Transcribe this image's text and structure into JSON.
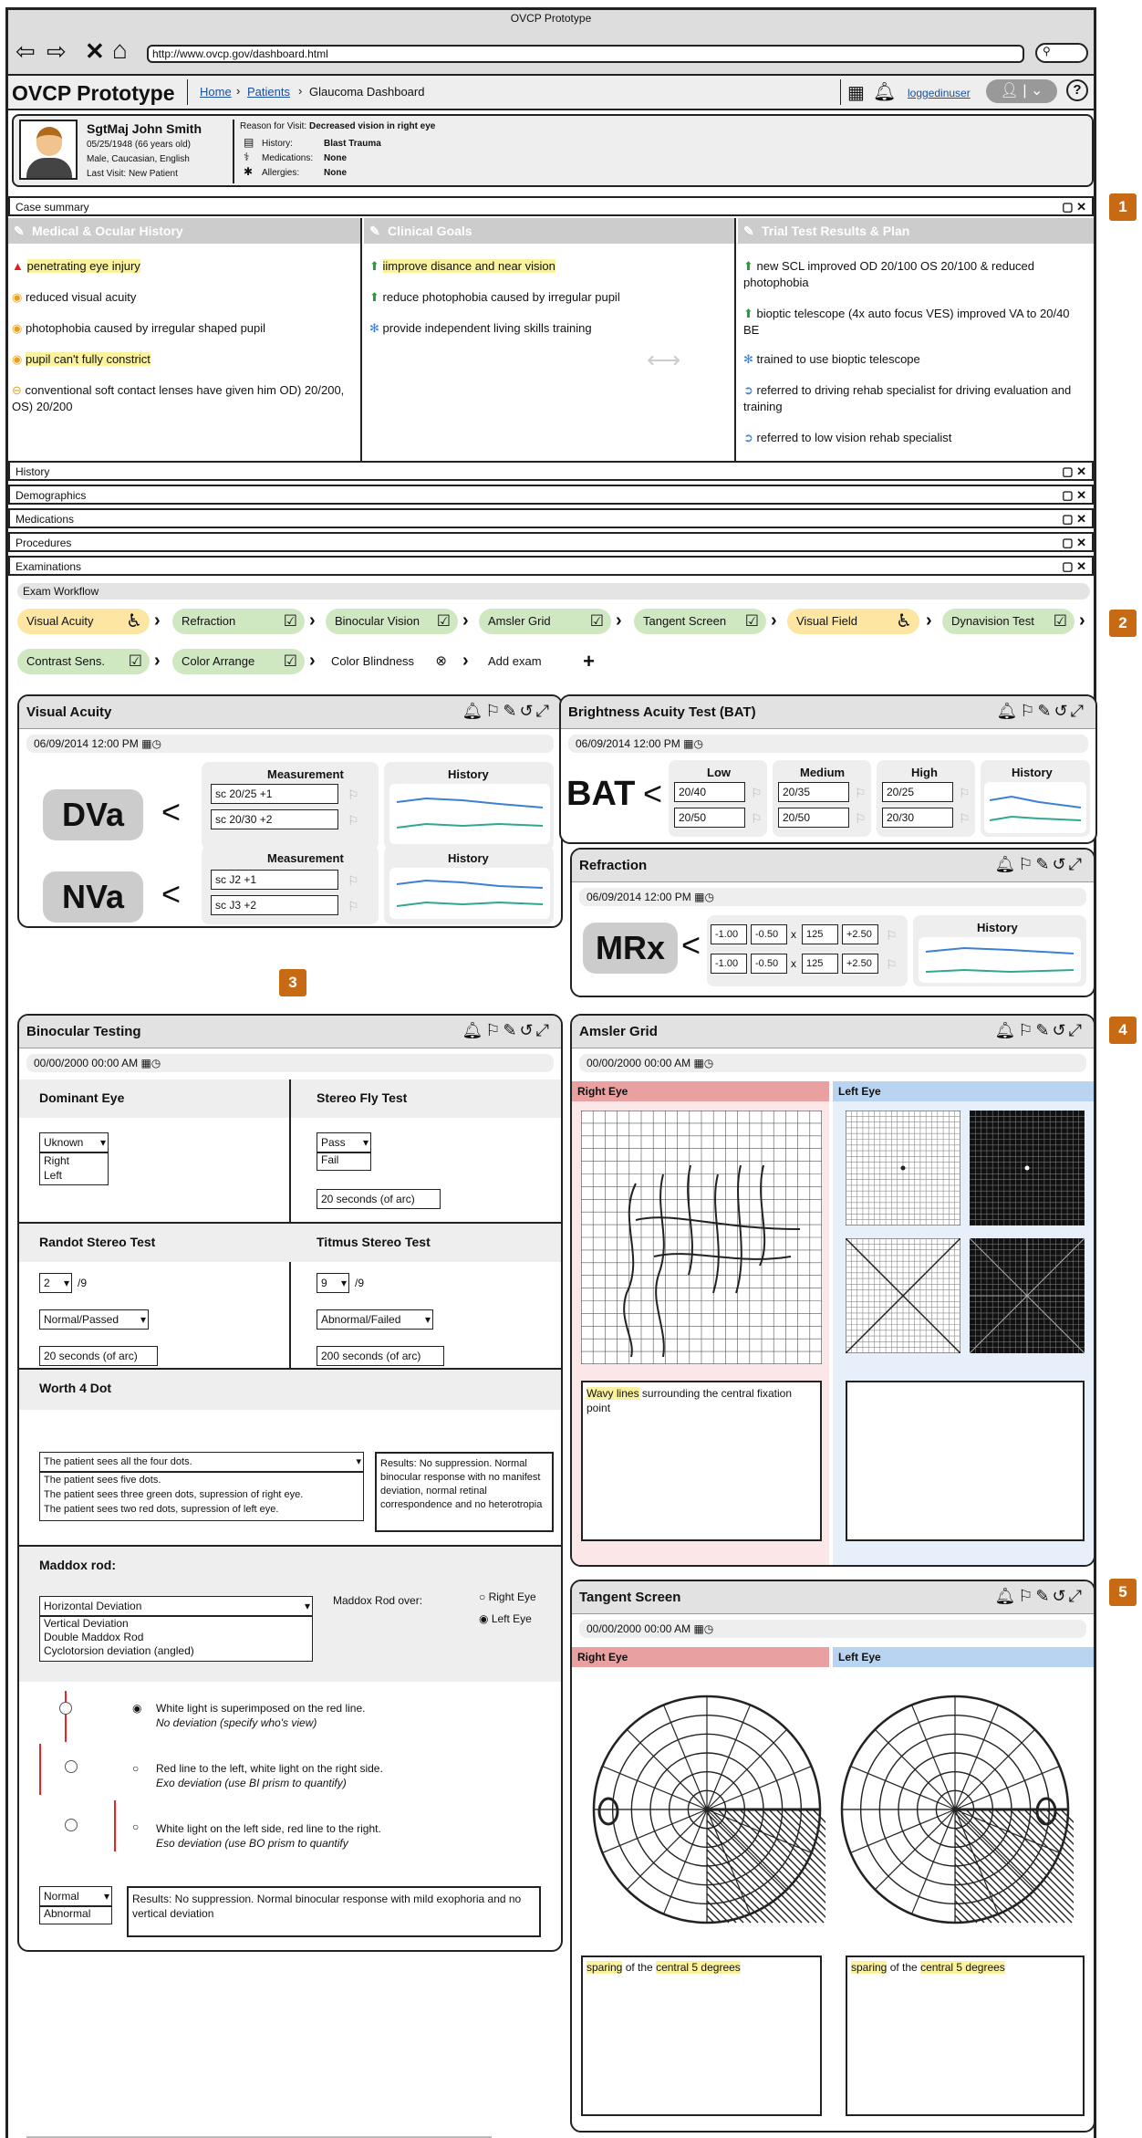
{
  "browser": {
    "title": "OVCP Prototype",
    "url": "http://www.ovcp.gov/dashboard.html"
  },
  "app": {
    "name": "OVCP Prototype",
    "crumbs": [
      "Home",
      "Patients",
      "Glaucoma Dashboard"
    ],
    "user": "loggedinuser"
  },
  "patient": {
    "name": "SgtMaj John Smith",
    "dob": "05/25/1948 (66 years old)",
    "demo": "Male, Caucasian, English",
    "last": "Last Visit: New Patient",
    "reason_label": "Reason for Visit:",
    "reason": "Decreased vision in right eye",
    "history_label": "History:",
    "history": "Blast Trauma",
    "meds_label": "Medications:",
    "meds": "None",
    "allergies_label": "Allergies:",
    "allergies": "None"
  },
  "bars": {
    "case": "Case summary",
    "history": "History",
    "demographics": "Demographics",
    "medications": "Medications",
    "procedures": "Procedures",
    "examinations": "Examinations"
  },
  "badges": [
    "1",
    "2",
    "3",
    "4",
    "5"
  ],
  "summary": {
    "col1": {
      "title": "Medical & Ocular History",
      "items": [
        "penetrating eye injury",
        "reduced visual acuity",
        "photophobia caused by irregular shaped pupil",
        "pupil can't fully constrict",
        "conventional soft contact lenses have given him OD) 20/200, OS) 20/200"
      ]
    },
    "col2": {
      "title": "Clinical Goals",
      "items": [
        "iimprove disance and near vision",
        "reduce photophobia caused by irregular pupil",
        "provide independent living skills training"
      ]
    },
    "col3": {
      "title": "Trial Test Results & Plan",
      "items": [
        "new SCL improved OD 20/100 OS 20/100 & reduced photophobia",
        "bioptic telescope (4x auto focus VES) improved VA to 20/40 BE",
        "trained to use bioptic telescope",
        "referred to driving rehab specialist for driving evaluation and training",
        "referred to low vision rehab specialist"
      ]
    }
  },
  "workflow": {
    "title": "Exam Workflow",
    "row1": [
      "Visual Acuity",
      "Refraction",
      "Binocular Vision",
      "Amsler Grid",
      "Tangent Screen",
      "Visual Field",
      "Dynavision Test"
    ],
    "row2": [
      "Contrast Sens.",
      "Color Arrange",
      "Color Blindness",
      "Add exam"
    ]
  },
  "va": {
    "title": "Visual Acuity",
    "date": "06/09/2014 12:00 PM",
    "measurement": "Measurement",
    "history": "History",
    "dva": "DVa",
    "nva": "NVa",
    "dva_vals": [
      "sc 20/25 +1",
      "sc 20/30 +2"
    ],
    "nva_vals": [
      "sc J2 +1",
      "sc J3 +2"
    ]
  },
  "bat": {
    "title": "Brightness Acuity Test (BAT)",
    "date": "06/09/2014 12:00 PM",
    "big": "BAT",
    "low": "Low",
    "medium": "Medium",
    "high": "High",
    "history": "History",
    "low_vals": [
      "20/40",
      "20/50"
    ],
    "med_vals": [
      "20/35",
      "20/50"
    ],
    "high_vals": [
      "20/25",
      "20/30"
    ]
  },
  "refraction": {
    "title": "Refraction",
    "date": "06/09/2014 12:00 PM",
    "big": "MRx",
    "history": "History",
    "row1": [
      "-1.00",
      "-0.50",
      "125",
      "+2.50"
    ],
    "row2": [
      "-1.00",
      "-0.50",
      "125",
      "+2.50"
    ]
  },
  "binocular": {
    "title": "Binocular Testing",
    "date": "00/00/2000 00:00 AM",
    "dominant": {
      "title": "Dominant Eye",
      "sel": "Uknown",
      "opts": [
        "Right",
        "Left"
      ]
    },
    "stereofly": {
      "title": "Stereo Fly Test",
      "sel": "Pass",
      "opts": [
        "Fail"
      ],
      "secs": "20 seconds (of arc)"
    },
    "randot": {
      "title": "Randot Stereo Test",
      "num": "2",
      "of": "/9",
      "result": "Normal/Passed",
      "secs": "20 seconds (of arc)"
    },
    "titmus": {
      "title": "Titmus Stereo Test",
      "num": "9",
      "of": "/9",
      "result": "Abnormal/Failed",
      "secs": "200 seconds (of arc)"
    },
    "worth": {
      "title": "Worth 4 Dot",
      "sel": "The patient sees all the four dots.",
      "opts": [
        "The patient sees five dots.",
        "The patient sees three green dots, supression of right eye.",
        "The patient sees two red dots, supression of left eye."
      ],
      "result": "Results: No suppression. Normal binocular response with no manifest deviation, normal retinal correspondence and no heterotropia"
    },
    "maddox": {
      "title": "Maddox rod:",
      "sel": "Horizontal Deviation",
      "opts": [
        "Vertical Deviation",
        "Double Maddox Rod",
        "Cyclotorsion deviation (angled)"
      ],
      "over": "Maddox Rod over:",
      "right": "Right Eye",
      "left": "Left Eye",
      "opt1a": "White light is superimposed on the red line.",
      "opt1b": "No deviation (specify who's view)",
      "opt2a": "Red line to the left, white light on the right side.",
      "opt2b": "Exo deviation (use BI prism to quantify)",
      "opt3a": "White light on the left side, red line to the right.",
      "opt3b": "Eso deviation (use BO prism to quantify",
      "normal": "Normal",
      "abnormal": "Abnormal",
      "result": "Results: No suppression. Normal binocular response with mild exophoria and no vertical deviation"
    }
  },
  "amsler": {
    "title": "Amsler Grid",
    "date": "00/00/2000 00:00 AM",
    "right": "Right Eye",
    "left": "Left Eye",
    "note_hl": "Wavy lines",
    "note": " surrounding the central fixation point"
  },
  "tangent": {
    "title": "Tangent Screen",
    "date": "00/00/2000 00:00 AM",
    "right": "Right Eye",
    "left": "Left Eye",
    "note_a": "sparing",
    "note_b": " of the ",
    "note_c": "central 5 degrees"
  },
  "colors": {
    "red": "#e8a0a0",
    "blue": "#b9d4f1",
    "yellow": "#fbf2a0",
    "green": "#cfe8c2",
    "orange": "#c86a14",
    "line_blue": "#3c7fd6",
    "line_teal": "#2fa88e"
  }
}
